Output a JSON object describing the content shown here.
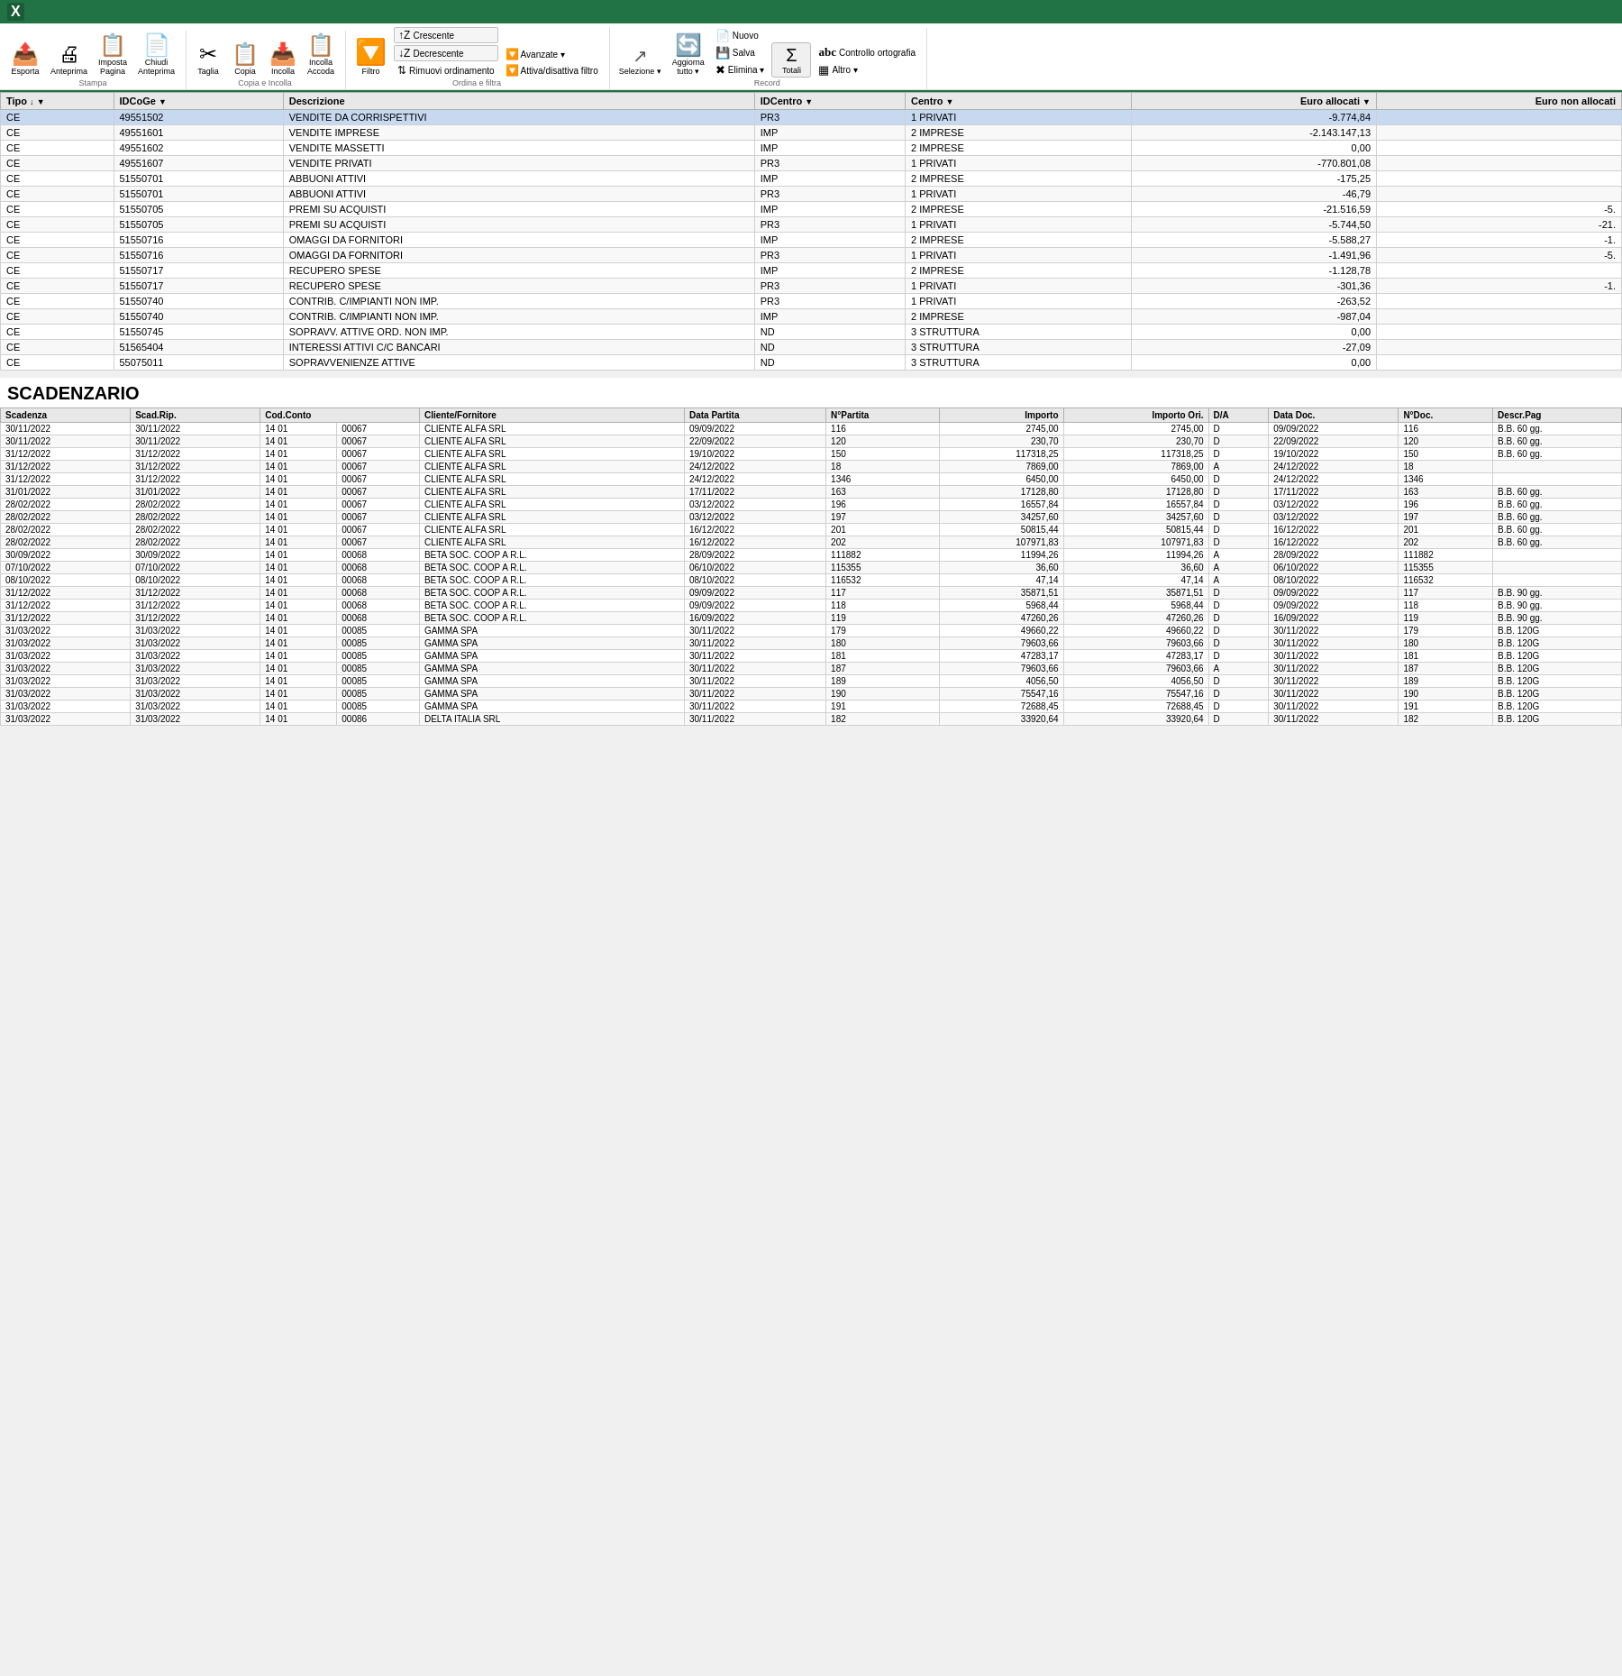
{
  "topbar": {
    "app_icon": "🟩",
    "title": "Excel"
  },
  "ribbon": {
    "groups": [
      {
        "label": "Stampa",
        "items": [
          {
            "id": "esporta",
            "icon": "📤",
            "label": "Esporta"
          },
          {
            "id": "anteprima",
            "icon": "📄",
            "label": "Anteprima"
          },
          {
            "id": "imposta_pagina",
            "icon": "📋",
            "label": "Imposta\nPagina"
          },
          {
            "id": "chiudi_anteprima",
            "icon": "✖",
            "label": "Chiudi\nAnteprima"
          }
        ]
      },
      {
        "label": "Copia e Incolla",
        "items": [
          {
            "id": "taglia",
            "icon": "✂",
            "label": "Taglia"
          },
          {
            "id": "copia",
            "icon": "📋",
            "label": "Copia"
          },
          {
            "id": "incolla",
            "icon": "📥",
            "label": "Incolla"
          },
          {
            "id": "incolla_accoda",
            "icon": "📋",
            "label": "Incolla\nAccoda"
          }
        ]
      },
      {
        "label": "Ordina e filtra",
        "items_col": [
          {
            "id": "filtro",
            "icon": "🔽",
            "label": "Filtro",
            "big": true
          },
          {
            "id": "crescente",
            "icon": "↑",
            "label": "Crescente"
          },
          {
            "id": "decrescente",
            "icon": "↓",
            "label": "Decrescente"
          },
          {
            "id": "rimuovi_ordinamento",
            "icon": "🔃",
            "label": "Rimuovi ordinamento"
          },
          {
            "id": "avanzate",
            "icon": "🔽",
            "label": "Avanzate"
          },
          {
            "id": "attiva_disattiva_filtro",
            "icon": "🔽",
            "label": "Attiva/disattiva filtro"
          }
        ]
      },
      {
        "label": "",
        "items": [
          {
            "id": "selezione",
            "icon": "↗",
            "label": "Selezione"
          },
          {
            "id": "aggiorna_tutto",
            "icon": "🔄",
            "label": "Aggiorna\ntutto"
          },
          {
            "id": "nuovo",
            "icon": "📄",
            "label": "Nuovo"
          },
          {
            "id": "salva",
            "icon": "💾",
            "label": "Salva"
          },
          {
            "id": "elimina",
            "icon": "✖",
            "label": "Elimina"
          },
          {
            "id": "totali",
            "icon": "Σ",
            "label": "Totali"
          },
          {
            "id": "controllo_ortografia",
            "icon": "abc",
            "label": "Controllo ortografia"
          },
          {
            "id": "altro",
            "icon": "▦",
            "label": "Altro"
          }
        ]
      }
    ],
    "record_label": "Record"
  },
  "main_table": {
    "columns": [
      {
        "id": "tipo",
        "label": "Tipo",
        "sort": "↓",
        "filter": true
      },
      {
        "id": "idcoge",
        "label": "IDCoGe",
        "sort": "",
        "filter": true
      },
      {
        "id": "descrizione",
        "label": "Descrizione",
        "sort": "",
        "filter": false
      },
      {
        "id": "idcentro",
        "label": "IDCentro",
        "sort": "",
        "filter": true
      },
      {
        "id": "centro",
        "label": "Centro",
        "sort": "",
        "filter": false
      },
      {
        "id": "euro_allocati",
        "label": "Euro allocati",
        "sort": "",
        "filter": true
      },
      {
        "id": "euro_non_allocati",
        "label": "Euro non allocati",
        "sort": "",
        "filter": false
      }
    ],
    "rows": [
      {
        "tipo": "CE",
        "idcoge": "49551502",
        "descrizione": "VENDITE DA CORRISPETTIVI",
        "idcentro": "PR3",
        "centro": "1 PRIVATI",
        "euro_allocati": "-9.774,84",
        "euro_non_allocati": "",
        "selected": true
      },
      {
        "tipo": "CE",
        "idcoge": "49551601",
        "descrizione": "VENDITE IMPRESE",
        "idcentro": "IMP",
        "centro": "2 IMPRESE",
        "euro_allocati": "-2.143.147,13",
        "euro_non_allocati": ""
      },
      {
        "tipo": "CE",
        "idcoge": "49551602",
        "descrizione": "VENDITE MASSETTI",
        "idcentro": "IMP",
        "centro": "2 IMPRESE",
        "euro_allocati": "0,00",
        "euro_non_allocati": ""
      },
      {
        "tipo": "CE",
        "idcoge": "49551607",
        "descrizione": "VENDITE PRIVATI",
        "idcentro": "PR3",
        "centro": "1 PRIVATI",
        "euro_allocati": "-770.801,08",
        "euro_non_allocati": ""
      },
      {
        "tipo": "CE",
        "idcoge": "51550701",
        "descrizione": "ABBUONI ATTIVI",
        "idcentro": "IMP",
        "centro": "2 IMPRESE",
        "euro_allocati": "-175,25",
        "euro_non_allocati": ""
      },
      {
        "tipo": "CE",
        "idcoge": "51550701",
        "descrizione": "ABBUONI ATTIVI",
        "idcentro": "PR3",
        "centro": "1 PRIVATI",
        "euro_allocati": "-46,79",
        "euro_non_allocati": ""
      },
      {
        "tipo": "CE",
        "idcoge": "51550705",
        "descrizione": "PREMI SU ACQUISTI",
        "idcentro": "IMP",
        "centro": "2 IMPRESE",
        "euro_allocati": "-21.516,59",
        "euro_non_allocati": "-5."
      },
      {
        "tipo": "CE",
        "idcoge": "51550705",
        "descrizione": "PREMI SU ACQUISTI",
        "idcentro": "PR3",
        "centro": "1 PRIVATI",
        "euro_allocati": "-5.744,50",
        "euro_non_allocati": "-21."
      },
      {
        "tipo": "CE",
        "idcoge": "51550716",
        "descrizione": "OMAGGI DA FORNITORI",
        "idcentro": "IMP",
        "centro": "2 IMPRESE",
        "euro_allocati": "-5.588,27",
        "euro_non_allocati": "-1."
      },
      {
        "tipo": "CE",
        "idcoge": "51550716",
        "descrizione": "OMAGGI DA FORNITORI",
        "idcentro": "PR3",
        "centro": "1 PRIVATI",
        "euro_allocati": "-1.491,96",
        "euro_non_allocati": "-5."
      },
      {
        "tipo": "CE",
        "idcoge": "51550717",
        "descrizione": "RECUPERO SPESE",
        "idcentro": "IMP",
        "centro": "2 IMPRESE",
        "euro_allocati": "-1.128,78",
        "euro_non_allocati": ""
      },
      {
        "tipo": "CE",
        "idcoge": "51550717",
        "descrizione": "RECUPERO SPESE",
        "idcentro": "PR3",
        "centro": "1 PRIVATI",
        "euro_allocati": "-301,36",
        "euro_non_allocati": "-1."
      },
      {
        "tipo": "CE",
        "idcoge": "51550740",
        "descrizione": "CONTRIB. C/IMPIANTI NON IMP.",
        "idcentro": "PR3",
        "centro": "1 PRIVATI",
        "euro_allocati": "-263,52",
        "euro_non_allocati": ""
      },
      {
        "tipo": "CE",
        "idcoge": "51550740",
        "descrizione": "CONTRIB. C/IMPIANTI NON IMP.",
        "idcentro": "IMP",
        "centro": "2 IMPRESE",
        "euro_allocati": "-987,04",
        "euro_non_allocati": ""
      },
      {
        "tipo": "CE",
        "idcoge": "51550745",
        "descrizione": "SOPRAVV. ATTIVE ORD. NON IMP.",
        "idcentro": "ND",
        "centro": "3 STRUTTURA",
        "euro_allocati": "0,00",
        "euro_non_allocati": ""
      },
      {
        "tipo": "CE",
        "idcoge": "51565404",
        "descrizione": "INTERESSI ATTIVI C/C BANCARI",
        "idcentro": "ND",
        "centro": "3 STRUTTURA",
        "euro_allocati": "-27,09",
        "euro_non_allocati": ""
      },
      {
        "tipo": "CE",
        "idcoge": "55075011",
        "descrizione": "SOPRAVVENIENZE ATTIVE",
        "idcentro": "ND",
        "centro": "3 STRUTTURA",
        "euro_allocati": "0,00",
        "euro_non_allocati": ""
      }
    ]
  },
  "scadenzario": {
    "title": "SCADENZARIO",
    "columns": [
      "Scadenza",
      "Scad.Rip.",
      "Cod.Conto",
      "",
      "Cliente/Fornitore",
      "Data Partita",
      "N°Partita",
      "Importo",
      "Importo Ori.",
      "D/A",
      "Data Doc.",
      "N°Doc.",
      "Descr.Pag"
    ],
    "rows": [
      {
        "scadenza": "30/11/2022",
        "scad_rip": "30/11/2022",
        "cod_conto": "14 01",
        "cod2": "00067",
        "cliente": "CLIENTE ALFA SRL",
        "data_partita": "09/09/2022",
        "n_partita": "116",
        "importo": "2745,00",
        "importo_ori": "2745,00",
        "da": "D",
        "data_doc": "09/09/2022",
        "n_doc": "116",
        "descr": "B.B. 60 gg."
      },
      {
        "scadenza": "30/11/2022",
        "scad_rip": "30/11/2022",
        "cod_conto": "14 01",
        "cod2": "00067",
        "cliente": "CLIENTE ALFA SRL",
        "data_partita": "22/09/2022",
        "n_partita": "120",
        "importo": "230,70",
        "importo_ori": "230,70",
        "da": "D",
        "data_doc": "22/09/2022",
        "n_doc": "120",
        "descr": "B.B. 60 gg."
      },
      {
        "scadenza": "31/12/2022",
        "scad_rip": "31/12/2022",
        "cod_conto": "14 01",
        "cod2": "00067",
        "cliente": "CLIENTE ALFA SRL",
        "data_partita": "19/10/2022",
        "n_partita": "150",
        "importo": "117318,25",
        "importo_ori": "117318,25",
        "da": "D",
        "data_doc": "19/10/2022",
        "n_doc": "150",
        "descr": "B.B. 60 gg."
      },
      {
        "scadenza": "31/12/2022",
        "scad_rip": "31/12/2022",
        "cod_conto": "14 01",
        "cod2": "00067",
        "cliente": "CLIENTE ALFA SRL",
        "data_partita": "24/12/2022",
        "n_partita": "18",
        "importo": "7869,00",
        "importo_ori": "7869,00",
        "da": "A",
        "data_doc": "24/12/2022",
        "n_doc": "18",
        "descr": ""
      },
      {
        "scadenza": "31/12/2022",
        "scad_rip": "31/12/2022",
        "cod_conto": "14 01",
        "cod2": "00067",
        "cliente": "CLIENTE ALFA SRL",
        "data_partita": "24/12/2022",
        "n_partita": "1346",
        "importo": "6450,00",
        "importo_ori": "6450,00",
        "da": "D",
        "data_doc": "24/12/2022",
        "n_doc": "1346",
        "descr": ""
      },
      {
        "scadenza": "31/01/2022",
        "scad_rip": "31/01/2022",
        "cod_conto": "14 01",
        "cod2": "00067",
        "cliente": "CLIENTE ALFA SRL",
        "data_partita": "17/11/2022",
        "n_partita": "163",
        "importo": "17128,80",
        "importo_ori": "17128,80",
        "da": "D",
        "data_doc": "17/11/2022",
        "n_doc": "163",
        "descr": "B.B. 60 gg."
      },
      {
        "scadenza": "28/02/2022",
        "scad_rip": "28/02/2022",
        "cod_conto": "14 01",
        "cod2": "00067",
        "cliente": "CLIENTE ALFA SRL",
        "data_partita": "03/12/2022",
        "n_partita": "196",
        "importo": "16557,84",
        "importo_ori": "16557,84",
        "da": "D",
        "data_doc": "03/12/2022",
        "n_doc": "196",
        "descr": "B.B. 60 gg."
      },
      {
        "scadenza": "28/02/2022",
        "scad_rip": "28/02/2022",
        "cod_conto": "14 01",
        "cod2": "00067",
        "cliente": "CLIENTE ALFA SRL",
        "data_partita": "03/12/2022",
        "n_partita": "197",
        "importo": "34257,60",
        "importo_ori": "34257,60",
        "da": "D",
        "data_doc": "03/12/2022",
        "n_doc": "197",
        "descr": "B.B. 60 gg."
      },
      {
        "scadenza": "28/02/2022",
        "scad_rip": "28/02/2022",
        "cod_conto": "14 01",
        "cod2": "00067",
        "cliente": "CLIENTE ALFA SRL",
        "data_partita": "16/12/2022",
        "n_partita": "201",
        "importo": "50815,44",
        "importo_ori": "50815,44",
        "da": "D",
        "data_doc": "16/12/2022",
        "n_doc": "201",
        "descr": "B.B. 60 gg."
      },
      {
        "scadenza": "28/02/2022",
        "scad_rip": "28/02/2022",
        "cod_conto": "14 01",
        "cod2": "00067",
        "cliente": "CLIENTE ALFA SRL",
        "data_partita": "16/12/2022",
        "n_partita": "202",
        "importo": "107971,83",
        "importo_ori": "107971,83",
        "da": "D",
        "data_doc": "16/12/2022",
        "n_doc": "202",
        "descr": "B.B. 60 gg."
      },
      {
        "scadenza": "30/09/2022",
        "scad_rip": "30/09/2022",
        "cod_conto": "14 01",
        "cod2": "00068",
        "cliente": "BETA SOC. COOP A R.L.",
        "data_partita": "28/09/2022",
        "n_partita": "111882",
        "importo": "11994,26",
        "importo_ori": "11994,26",
        "da": "A",
        "data_doc": "28/09/2022",
        "n_doc": "111882",
        "descr": ""
      },
      {
        "scadenza": "07/10/2022",
        "scad_rip": "07/10/2022",
        "cod_conto": "14 01",
        "cod2": "00068",
        "cliente": "BETA SOC. COOP A R.L.",
        "data_partita": "06/10/2022",
        "n_partita": "115355",
        "importo": "36,60",
        "importo_ori": "36,60",
        "da": "A",
        "data_doc": "06/10/2022",
        "n_doc": "115355",
        "descr": ""
      },
      {
        "scadenza": "08/10/2022",
        "scad_rip": "08/10/2022",
        "cod_conto": "14 01",
        "cod2": "00068",
        "cliente": "BETA SOC. COOP A R.L.",
        "data_partita": "08/10/2022",
        "n_partita": "116532",
        "importo": "47,14",
        "importo_ori": "47,14",
        "da": "A",
        "data_doc": "08/10/2022",
        "n_doc": "116532",
        "descr": ""
      },
      {
        "scadenza": "31/12/2022",
        "scad_rip": "31/12/2022",
        "cod_conto": "14 01",
        "cod2": "00068",
        "cliente": "BETA SOC. COOP A R.L.",
        "data_partita": "09/09/2022",
        "n_partita": "117",
        "importo": "35871,51",
        "importo_ori": "35871,51",
        "da": "D",
        "data_doc": "09/09/2022",
        "n_doc": "117",
        "descr": "B.B. 90 gg."
      },
      {
        "scadenza": "31/12/2022",
        "scad_rip": "31/12/2022",
        "cod_conto": "14 01",
        "cod2": "00068",
        "cliente": "BETA SOC. COOP A R.L.",
        "data_partita": "09/09/2022",
        "n_partita": "118",
        "importo": "5968,44",
        "importo_ori": "5968,44",
        "da": "D",
        "data_doc": "09/09/2022",
        "n_doc": "118",
        "descr": "B.B. 90 gg."
      },
      {
        "scadenza": "31/12/2022",
        "scad_rip": "31/12/2022",
        "cod_conto": "14 01",
        "cod2": "00068",
        "cliente": "BETA SOC. COOP A R.L.",
        "data_partita": "16/09/2022",
        "n_partita": "119",
        "importo": "47260,26",
        "importo_ori": "47260,26",
        "da": "D",
        "data_doc": "16/09/2022",
        "n_doc": "119",
        "descr": "B.B. 90 gg."
      },
      {
        "scadenza": "31/03/2022",
        "scad_rip": "31/03/2022",
        "cod_conto": "14 01",
        "cod2": "00085",
        "cliente": "GAMMA SPA",
        "data_partita": "30/11/2022",
        "n_partita": "179",
        "importo": "49660,22",
        "importo_ori": "49660,22",
        "da": "D",
        "data_doc": "30/11/2022",
        "n_doc": "179",
        "descr": "B.B. 120G"
      },
      {
        "scadenza": "31/03/2022",
        "scad_rip": "31/03/2022",
        "cod_conto": "14 01",
        "cod2": "00085",
        "cliente": "GAMMA SPA",
        "data_partita": "30/11/2022",
        "n_partita": "180",
        "importo": "79603,66",
        "importo_ori": "79603,66",
        "da": "D",
        "data_doc": "30/11/2022",
        "n_doc": "180",
        "descr": "B.B. 120G"
      },
      {
        "scadenza": "31/03/2022",
        "scad_rip": "31/03/2022",
        "cod_conto": "14 01",
        "cod2": "00085",
        "cliente": "GAMMA SPA",
        "data_partita": "30/11/2022",
        "n_partita": "181",
        "importo": "47283,17",
        "importo_ori": "47283,17",
        "da": "D",
        "data_doc": "30/11/2022",
        "n_doc": "181",
        "descr": "B.B. 120G"
      },
      {
        "scadenza": "31/03/2022",
        "scad_rip": "31/03/2022",
        "cod_conto": "14 01",
        "cod2": "00085",
        "cliente": "GAMMA SPA",
        "data_partita": "30/11/2022",
        "n_partita": "187",
        "importo": "79603,66",
        "importo_ori": "79603,66",
        "da": "A",
        "data_doc": "30/11/2022",
        "n_doc": "187",
        "descr": "B.B. 120G"
      },
      {
        "scadenza": "31/03/2022",
        "scad_rip": "31/03/2022",
        "cod_conto": "14 01",
        "cod2": "00085",
        "cliente": "GAMMA SPA",
        "data_partita": "30/11/2022",
        "n_partita": "189",
        "importo": "4056,50",
        "importo_ori": "4056,50",
        "da": "D",
        "data_doc": "30/11/2022",
        "n_doc": "189",
        "descr": "B.B. 120G"
      },
      {
        "scadenza": "31/03/2022",
        "scad_rip": "31/03/2022",
        "cod_conto": "14 01",
        "cod2": "00085",
        "cliente": "GAMMA SPA",
        "data_partita": "30/11/2022",
        "n_partita": "190",
        "importo": "75547,16",
        "importo_ori": "75547,16",
        "da": "D",
        "data_doc": "30/11/2022",
        "n_doc": "190",
        "descr": "B.B. 120G"
      },
      {
        "scadenza": "31/03/2022",
        "scad_rip": "31/03/2022",
        "cod_conto": "14 01",
        "cod2": "00085",
        "cliente": "GAMMA SPA",
        "data_partita": "30/11/2022",
        "n_partita": "191",
        "importo": "72688,45",
        "importo_ori": "72688,45",
        "da": "D",
        "data_doc": "30/11/2022",
        "n_doc": "191",
        "descr": "B.B. 120G"
      },
      {
        "scadenza": "31/03/2022",
        "scad_rip": "31/03/2022",
        "cod_conto": "14 01",
        "cod2": "00086",
        "cliente": "DELTA ITALIA SRL",
        "data_partita": "30/11/2022",
        "n_partita": "182",
        "importo": "33920,64",
        "importo_ori": "33920,64",
        "da": "D",
        "data_doc": "30/11/2022",
        "n_doc": "182",
        "descr": "B.B. 120G"
      }
    ]
  }
}
